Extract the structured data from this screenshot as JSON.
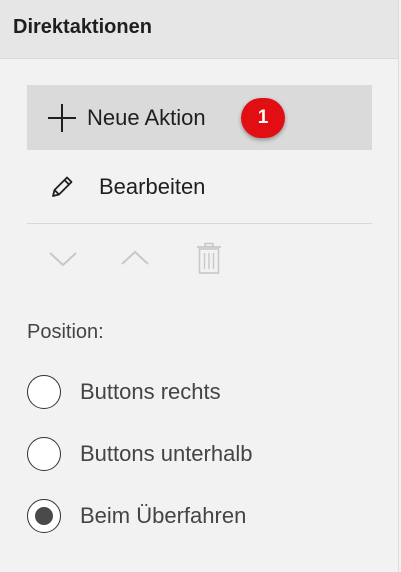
{
  "panel": {
    "title": "Direktaktionen"
  },
  "actions": {
    "new_label": "Neue Aktion",
    "edit_label": "Bearbeiten"
  },
  "badge": {
    "number": "1",
    "color": "#e10f14"
  },
  "toolbar": {
    "icons": [
      "chevron-down-icon",
      "chevron-up-icon",
      "trash-icon"
    ]
  },
  "position": {
    "label": "Position:",
    "options": [
      {
        "label": "Buttons rechts",
        "selected": false
      },
      {
        "label": "Buttons unterhalb",
        "selected": false
      },
      {
        "label": "Beim Überfahren",
        "selected": true
      }
    ]
  }
}
